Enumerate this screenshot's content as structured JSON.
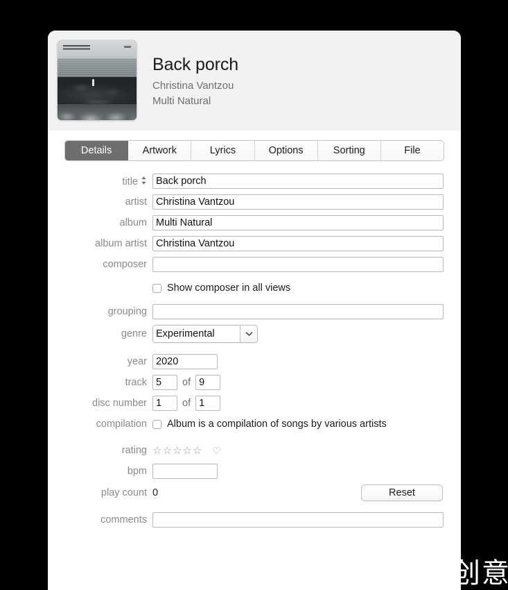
{
  "header": {
    "title": "Back porch",
    "artist": "Christina Vantzou",
    "album": "Multi Natural",
    "artwork_alt": "album-artwork-seascape",
    "background_color": "#f2f2f2"
  },
  "tabs": [
    {
      "label": "Details",
      "active": true
    },
    {
      "label": "Artwork",
      "active": false
    },
    {
      "label": "Lyrics",
      "active": false
    },
    {
      "label": "Options",
      "active": false
    },
    {
      "label": "Sorting",
      "active": false
    },
    {
      "label": "File",
      "active": false
    }
  ],
  "active_tab_color": "#6e6e6e",
  "form": {
    "title": {
      "label": "title",
      "value": "Back porch",
      "placeholder": ""
    },
    "artist": {
      "label": "artist",
      "value": "Christina Vantzou",
      "placeholder": ""
    },
    "album": {
      "label": "album",
      "value": "Multi Natural",
      "placeholder": ""
    },
    "album_artist": {
      "label": "album artist",
      "value": "Christina Vantzou",
      "placeholder": ""
    },
    "composer": {
      "label": "composer",
      "value": "",
      "placeholder": ""
    },
    "show_composer": {
      "label": "Show composer in all views",
      "checked": false
    },
    "grouping": {
      "label": "grouping",
      "value": "",
      "placeholder": ""
    },
    "genre": {
      "label": "genre",
      "value": "Experimental",
      "options": [
        "Experimental"
      ]
    },
    "year": {
      "label": "year",
      "value": "2020",
      "placeholder": ""
    },
    "track": {
      "label": "track",
      "value": "5",
      "of_label": "of",
      "total": "9"
    },
    "disc_number": {
      "label": "disc number",
      "value": "1",
      "of_label": "of",
      "total": "1"
    },
    "compilation": {
      "label": "compilation",
      "checkbox_label": "Album is a compilation of songs by various artists",
      "checked": false
    },
    "rating": {
      "label": "rating",
      "stars": [
        "☆",
        "☆",
        "☆",
        "☆",
        "☆"
      ],
      "value": 0,
      "love_icon": "♡"
    },
    "bpm": {
      "label": "bpm",
      "value": "",
      "placeholder": ""
    },
    "play_count": {
      "label": "play count",
      "value": "0",
      "reset_label": "Reset"
    },
    "comments": {
      "label": "comments",
      "value": "",
      "placeholder": ""
    }
  },
  "watermark": {
    "text": "创意"
  }
}
